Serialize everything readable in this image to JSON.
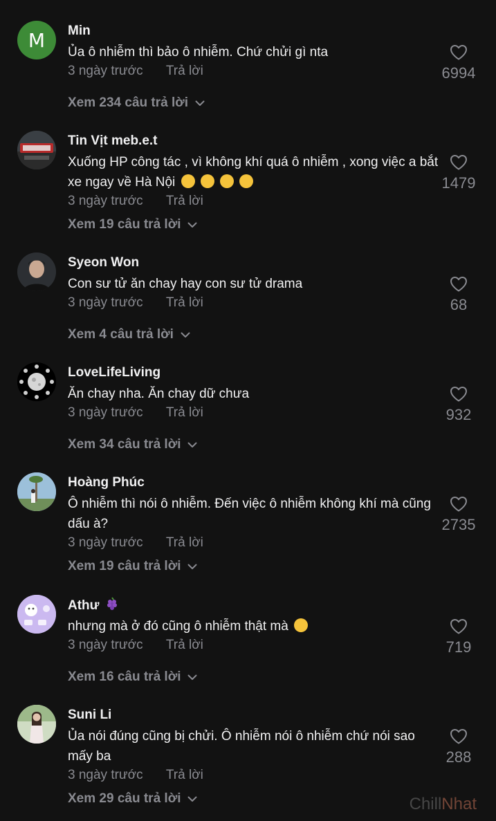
{
  "comments": [
    {
      "username": "Min",
      "avatar_letter": "M",
      "text": "Ủa ô nhiễm thì bảo ô nhiễm. Chứ chửi gì nta",
      "time": "3 ngày trước",
      "reply_label": "Trả lời",
      "view_replies": "Xem 234 câu trả lời",
      "likes": "6994"
    },
    {
      "username": "Tin Vịt meb.e.t",
      "text": "Xuống HP công tác , vì không khí quá ô nhiễm , xong việc a bắt xe ngay về Hà Nội",
      "emoji": "sweat-smile x4",
      "time": "3 ngày trước",
      "reply_label": "Trả lời",
      "view_replies": "Xem 19 câu trả lời",
      "likes": "1479"
    },
    {
      "username": "Syeon Won",
      "text": "Con sư tử ăn chay hay con sư tử drama",
      "time": "3 ngày trước",
      "reply_label": "Trả lời",
      "view_replies": "Xem 4 câu trả lời",
      "likes": "68"
    },
    {
      "username": "LoveLifeLiving",
      "text": "Ăn chay nha. Ăn chay dữ chưa",
      "time": "3 ngày trước",
      "reply_label": "Trả lời",
      "view_replies": "Xem 34 câu trả lời",
      "likes": "932"
    },
    {
      "username": "Hoàng Phúc",
      "text": "Ô nhiễm thì nói ô nhiễm. Đến việc ô nhiễm không khí mà cũng dấu à?",
      "time": "3 ngày trước",
      "reply_label": "Trả lời",
      "view_replies": "Xem 19 câu trả lời",
      "likes": "2735"
    },
    {
      "username": "Athư",
      "username_emoji": "grapes",
      "text": "nhưng mà ở đó cũng ô nhiễm thật mà",
      "emoji": "flushed-face",
      "time": "3 ngày trước",
      "reply_label": "Trả lời",
      "view_replies": "Xem 16 câu trả lời",
      "likes": "719"
    },
    {
      "username": "Suni Li",
      "text": "Ủa nói đúng cũng bị chửi. Ô nhiễm nói ô nhiễm chứ nói sao mấy ba",
      "time": "3 ngày trước",
      "reply_label": "Trả lời",
      "view_replies": "Xem 29 câu trả lời",
      "likes": "288"
    }
  ],
  "watermark": {
    "part1": "Chill",
    "part2": "Nhat"
  },
  "icons": {
    "like": "heart-outline-icon",
    "expand": "chevron-down-icon"
  },
  "colors": {
    "background": "#121212",
    "text": "#f1f1f2",
    "muted": "#8a8b91",
    "avatar_min": "#3d8b37"
  }
}
